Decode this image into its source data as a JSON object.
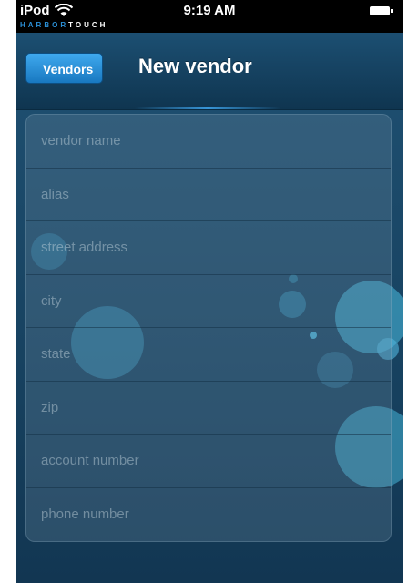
{
  "status_bar": {
    "carrier": "iPod",
    "time": "9:19 AM",
    "wifi_icon": "wifi-icon",
    "battery_icon": "battery-icon"
  },
  "brand": {
    "part_a": "HARBOR",
    "part_b": "TOUCH"
  },
  "nav": {
    "back_label": "Vendors",
    "title": "New vendor"
  },
  "form": {
    "fields": [
      {
        "value": "",
        "placeholder": "vendor name"
      },
      {
        "value": "",
        "placeholder": "alias"
      },
      {
        "value": "",
        "placeholder": "street address"
      },
      {
        "value": "",
        "placeholder": "city"
      },
      {
        "value": "",
        "placeholder": "state"
      },
      {
        "value": "",
        "placeholder": "zip"
      },
      {
        "value": "",
        "placeholder": "account number"
      },
      {
        "value": "",
        "placeholder": "phone number"
      }
    ]
  },
  "colors": {
    "accent": "#2b8fd6",
    "background": "#163d58",
    "status_bar": "#000000"
  }
}
